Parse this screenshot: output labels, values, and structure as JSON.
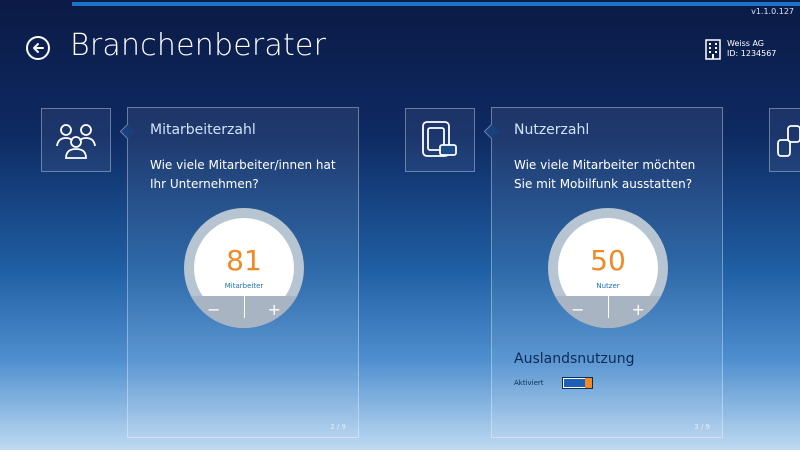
{
  "app": {
    "version": "v1.1.0.127",
    "title": "Branchenberater"
  },
  "company": {
    "name": "Weiss AG",
    "id": "ID: 1234567"
  },
  "colors": {
    "accent": "#f08a24",
    "blue": "#1b74c7"
  },
  "cards": [
    {
      "icon": "people-icon",
      "heading": "Mitarbeiterzahl",
      "question": "Wie viele Mitarbeiter/innen hat Ihr Unternehmen?",
      "value": "81",
      "unit": "Mitarbeiter",
      "minus": "−",
      "plus": "+",
      "page": "2 / 9"
    },
    {
      "icon": "mobile-devices-icon",
      "heading": "Nutzerzahl",
      "question": "Wie viele Mitarbeiter möchten Sie mit Mobilfunk ausstatten?",
      "value": "50",
      "unit": "Nutzer",
      "minus": "−",
      "plus": "+",
      "page": "3 / 9",
      "abroad_title": "Auslandsnutzung",
      "abroad_label": "Aktiviert",
      "abroad_enabled": true
    }
  ]
}
